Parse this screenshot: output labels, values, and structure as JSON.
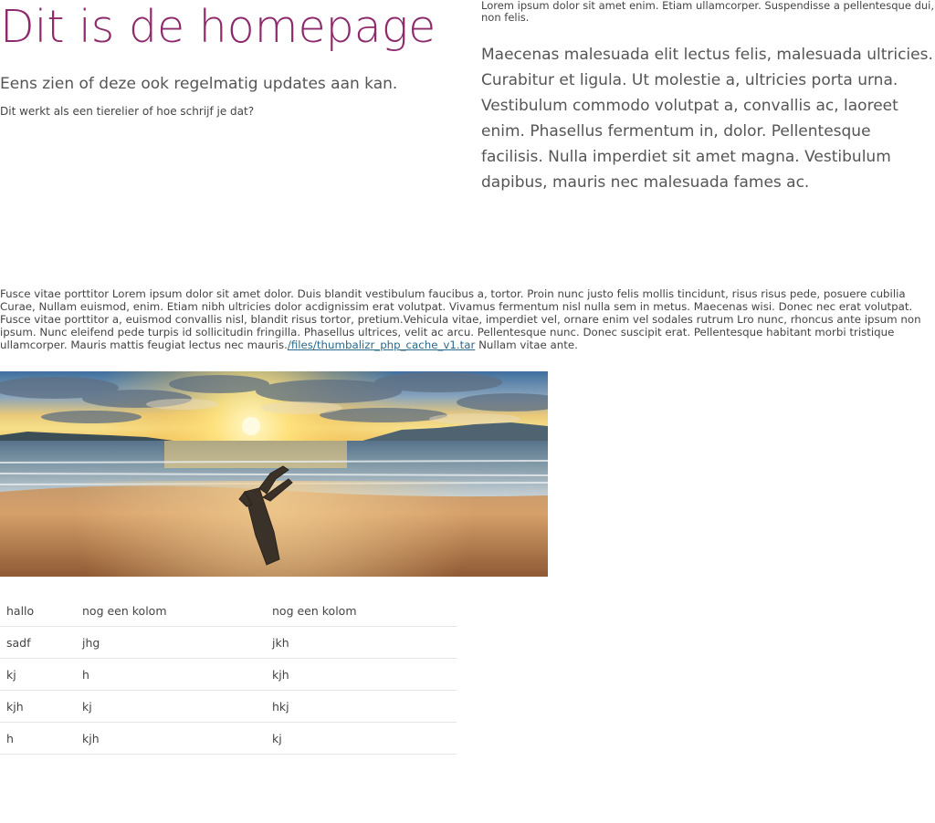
{
  "header": {
    "title": "Dit is de homepage",
    "subtitle": "Eens zien of deze ook regelmatig updates aan kan.",
    "question": "Dit werkt als een tierelier of hoe schrijf je dat?"
  },
  "aside": {
    "small_text": "Lorem ipsum dolor sit amet enim. Etiam ullamcorper. Suspendisse a pellentesque dui, non felis.",
    "large_text": "Maecenas malesuada elit lectus felis, malesuada ultricies. Curabitur et ligula. Ut molestie a, ultricies porta urna. Vestibulum commodo volutpat a, convallis ac, laoreet enim. Phasellus fermentum in, dolor. Pellentesque facilisis. Nulla imperdiet sit amet magna. Vestibulum dapibus, mauris nec malesuada fames ac."
  },
  "body": {
    "text_before_link": "Fusce vitae porttitor Lorem ipsum dolor sit amet dolor. Duis blandit vestibulum faucibus a, tortor. Proin nunc justo felis mollis tincidunt, risus risus pede, posuere cubilia Curae, Nullam euismod, enim. Etiam nibh ultricies dolor acdignissim erat volutpat. Vivamus fermentum nisl nulla sem in metus. Maecenas wisi. Donec nec erat volutpat. Fusce vitae porttitor a, euismod convallis nisl, blandit risus tortor, pretium.Vehicula vitae, imperdiet vel, ornare enim vel sodales rutrum Lro nunc, rhoncus ante ipsum non ipsum. Nunc eleifend pede turpis id sollicitudin fringilla. Phasellus ultrices, velit ac arcu. Pellentesque nunc. Donec suscipit erat. Pellentesque habitant morbi tristique ullamcorper. Mauris mattis feugiat lectus nec mauris.",
    "link_text": "/files/thumbalizr_php_cache_v1.tar",
    "text_after_link": " Nullam vitae ante."
  },
  "image": {
    "subject": "beach-sunset-driftwood"
  },
  "table": {
    "rows": [
      [
        "hallo",
        "nog een kolom",
        "nog een kolom"
      ],
      [
        "sadf",
        "jhg",
        "jkh"
      ],
      [
        "kj",
        "h",
        "kjh"
      ],
      [
        "kjh",
        "kj",
        "hkj"
      ],
      [
        "h",
        "kjh",
        "kj"
      ]
    ]
  },
  "colors": {
    "title": "#8e2a6c",
    "text": "#444444",
    "link": "#2a6a8a",
    "table_border": "#e4e4e4"
  }
}
